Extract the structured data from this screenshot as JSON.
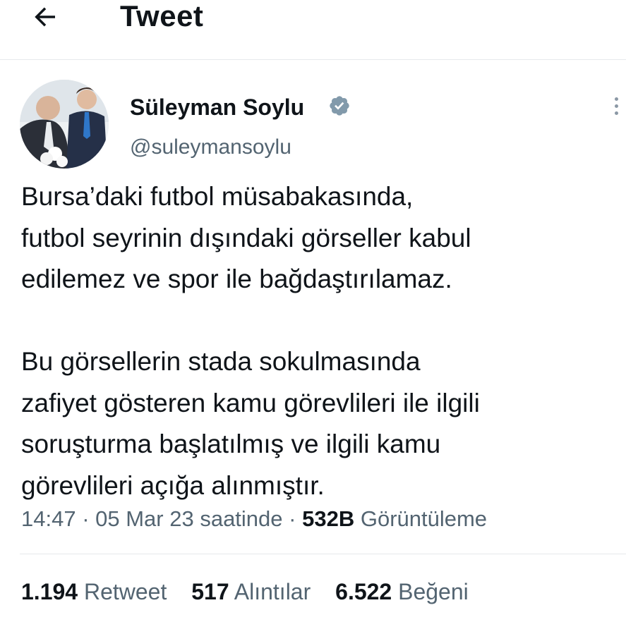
{
  "header": {
    "title": "Tweet",
    "back_icon": "arrow-left-icon"
  },
  "author": {
    "name": "Süleyman Soylu",
    "handle": "@suleymansoylu",
    "verified_icon": "verified-badge-icon",
    "verified_color": "#829aab"
  },
  "more_icon": "more-vertical-icon",
  "tweet": {
    "paragraphs": [
      [
        "Bursa’daki futbol müsabakasında,",
        "futbol seyrinin dışındaki görseller kabul",
        "edilemez ve spor ile bağdaştırılamaz."
      ],
      [
        "Bu görsellerin stada sokulmasında",
        "zafiyet gösteren kamu görevlileri ile ilgili",
        "soruşturma başlatılmış ve ilgili kamu",
        "görevlileri açığa alınmıştır."
      ]
    ]
  },
  "meta": {
    "time": "14:47",
    "date": "05 Mar 23 saatinde",
    "views_count": "532B",
    "views_label": "Görüntüleme"
  },
  "stats": {
    "retweets": {
      "count": "1.194",
      "label": "Retweet"
    },
    "quotes": {
      "count": "517",
      "label": "Alıntılar"
    },
    "likes": {
      "count": "6.522",
      "label": "Beğeni"
    }
  },
  "colors": {
    "text_primary": "#0f1419",
    "text_secondary": "#536471",
    "divider": "#e6e9ec"
  }
}
